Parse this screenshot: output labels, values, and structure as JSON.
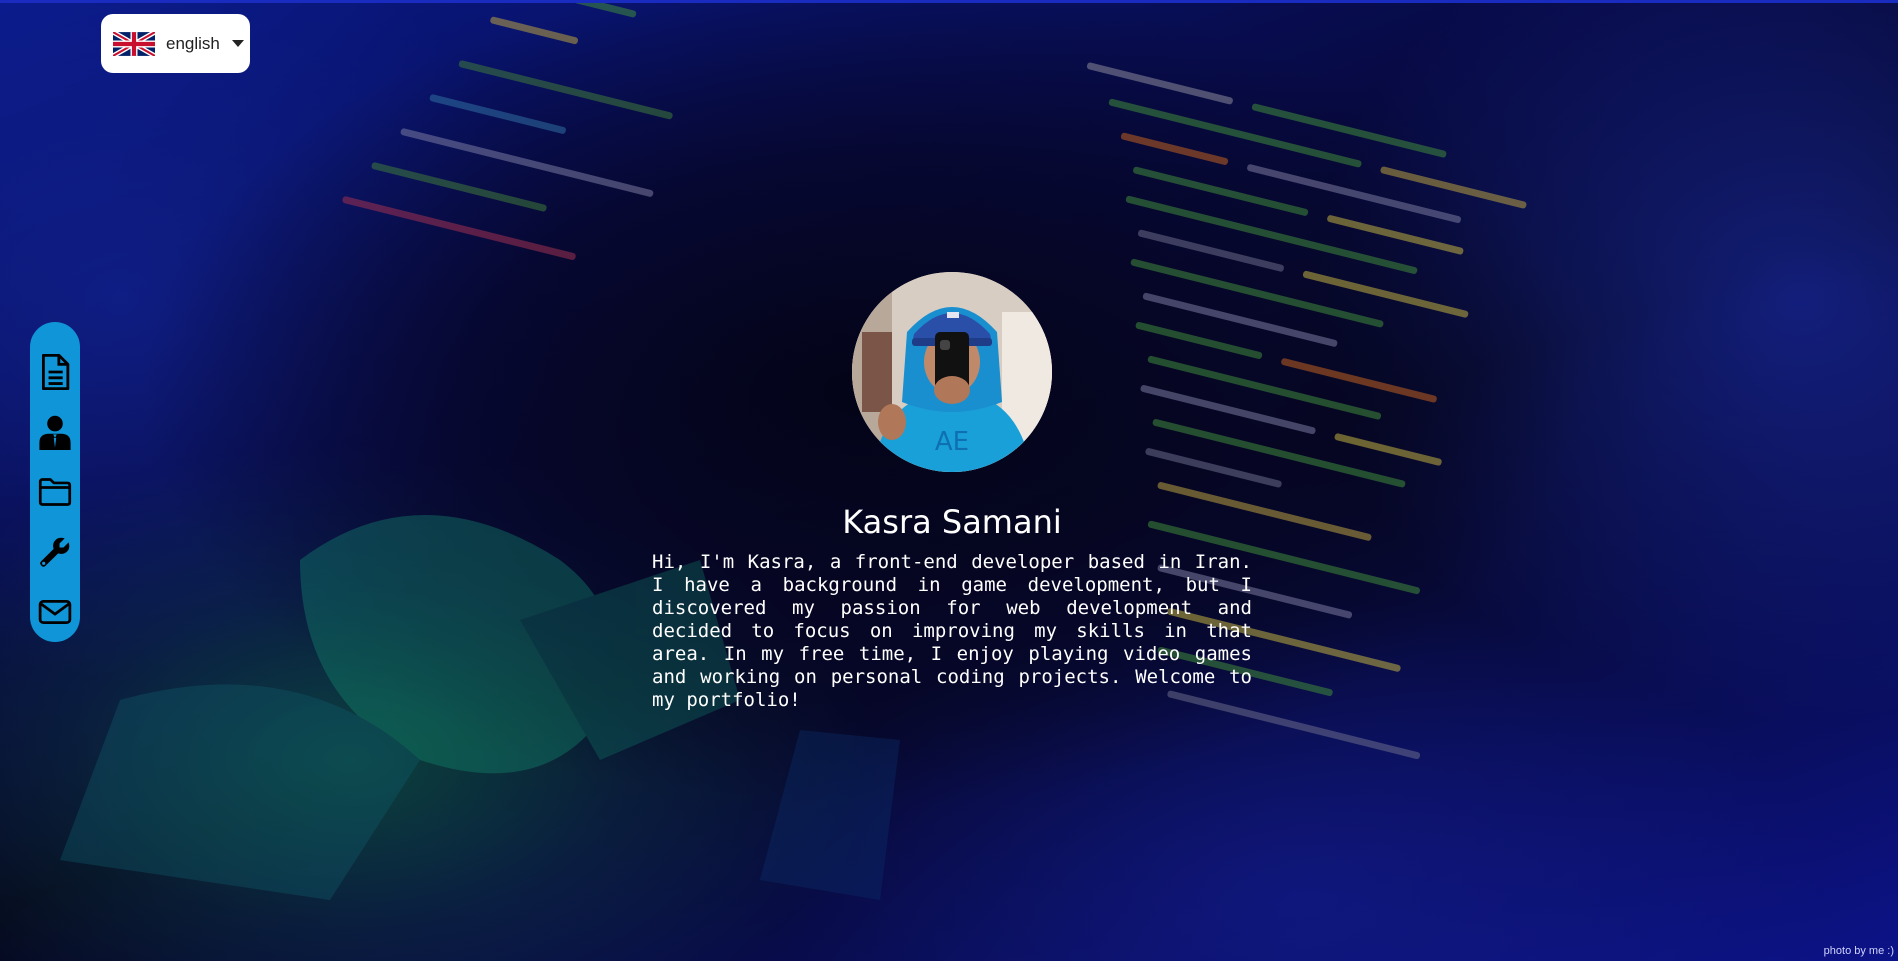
{
  "language_selector": {
    "flag_icon": "uk-flag-icon",
    "label": "english"
  },
  "sidenav": {
    "items": [
      {
        "icon": "document-icon",
        "name": "resume"
      },
      {
        "icon": "user-icon",
        "name": "about"
      },
      {
        "icon": "folder-icon",
        "name": "projects"
      },
      {
        "icon": "wrench-icon",
        "name": "skills"
      },
      {
        "icon": "envelope-icon",
        "name": "contact"
      }
    ]
  },
  "profile": {
    "name": "Kasra Samani",
    "bio": "Hi, I'm Kasra, a front-end developer based in Iran. I have a background in game development, but I discovered my passion for web development and decided to focus on improving my skills in that area. In my free time, I enjoy playing video games and working on personal coding projects. Welcome to my portfolio!"
  },
  "footer": {
    "credit": "photo by me :)"
  },
  "colors": {
    "nav_bg": "#1096d8",
    "text": "#ffffff",
    "background": "#05061c"
  }
}
